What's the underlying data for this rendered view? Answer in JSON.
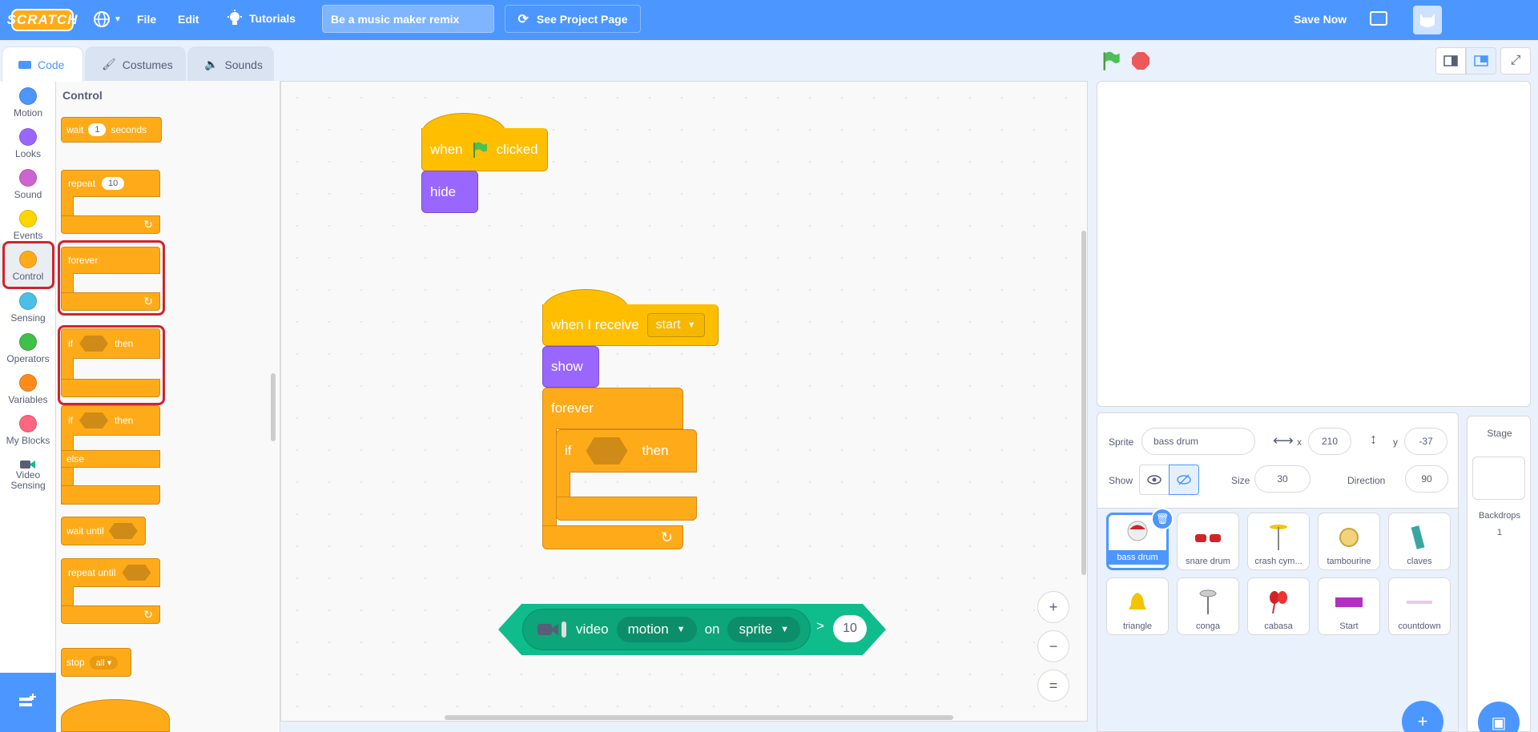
{
  "menu": {
    "logo": "SCRATCH",
    "file": "File",
    "edit": "Edit",
    "tutorials": "Tutorials",
    "project_title": "Be a music maker remix",
    "see_project": "See Project Page",
    "save_now": "Save Now"
  },
  "tabs": {
    "code": "Code",
    "costumes": "Costumes",
    "sounds": "Sounds"
  },
  "categories": [
    {
      "label": "Motion",
      "color": "#4c97ff"
    },
    {
      "label": "Looks",
      "color": "#9966ff"
    },
    {
      "label": "Sound",
      "color": "#cf63cf"
    },
    {
      "label": "Events",
      "color": "#ffd500"
    },
    {
      "label": "Control",
      "color": "#ffab19"
    },
    {
      "label": "Sensing",
      "color": "#4cbfe6"
    },
    {
      "label": "Operators",
      "color": "#40bf4a"
    },
    {
      "label": "Variables",
      "color": "#ff8c1a"
    },
    {
      "label": "My Blocks",
      "color": "#ff6680"
    },
    {
      "label": "Video Sensing",
      "color": "#0fbd8c"
    }
  ],
  "flyout": {
    "title": "Control",
    "wait": "wait",
    "wait_value": "1",
    "seconds": "seconds",
    "repeat": "repeat",
    "repeat_value": "10",
    "forever": "forever",
    "if": "if",
    "then": "then",
    "if2": "if",
    "then2": "then",
    "else": "else",
    "wait_until": "wait until",
    "repeat_until": "repeat until",
    "stop": "stop",
    "stop_option": "all"
  },
  "scripts": {
    "when": "when",
    "clicked": "clicked",
    "hide": "hide",
    "when_i_receive": "when I receive",
    "message": "start",
    "show": "show",
    "forever": "forever",
    "if": "if",
    "then": "then",
    "video": "video",
    "motion": "motion",
    "on": "on",
    "sprite": "sprite",
    "gt": ">",
    "threshold": "10"
  },
  "zoom": {
    "in": "+",
    "out": "−",
    "reset": "="
  },
  "sprite_info": {
    "sprite_label": "Sprite",
    "sprite_name": "bass drum",
    "x_label": "x",
    "x_value": "210",
    "y_label": "y",
    "y_value": "-37",
    "show_label": "Show",
    "size_label": "Size",
    "size_value": "30",
    "direction_label": "Direction",
    "direction_value": "90"
  },
  "sprites": [
    {
      "name": "bass drum",
      "selected": true
    },
    {
      "name": "snare drum"
    },
    {
      "name": "crash cym..."
    },
    {
      "name": "tambourine"
    },
    {
      "name": "claves"
    },
    {
      "name": "triangle"
    },
    {
      "name": "conga"
    },
    {
      "name": "cabasa"
    },
    {
      "name": "Start"
    },
    {
      "name": "countdown"
    }
  ],
  "stage_panel": {
    "title": "Stage",
    "backdrops_label": "Backdrops",
    "backdrops_count": "1"
  },
  "colors": {
    "accent": "#4c97ff",
    "control": "#ffab19",
    "events": "#ffbf00",
    "looks": "#9966ff",
    "video": "#0fbd8c",
    "highlight": "#d0242b"
  }
}
